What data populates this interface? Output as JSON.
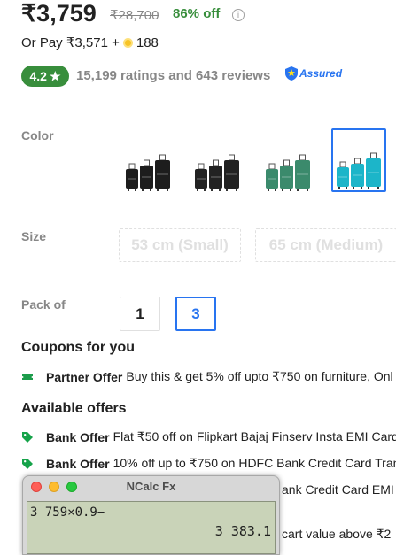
{
  "price": {
    "current": "₹3,759",
    "mrp": "₹28,700",
    "discount": "86% off",
    "or_pay": "Or Pay ₹3,571 +",
    "coins": "188"
  },
  "rating": {
    "value": "4.2",
    "star": "★",
    "summary": "15,199 ratings and 643 reviews",
    "assured_label": "Assured"
  },
  "labels": {
    "color": "Color",
    "size": "Size",
    "pack": "Pack of"
  },
  "color_options": [
    {
      "name": "black",
      "colors": [
        "#1d1d1d",
        "#1d1d1d",
        "#1d1d1d"
      ],
      "selected": false
    },
    {
      "name": "black-alt",
      "colors": [
        "#222222",
        "#222222",
        "#222222"
      ],
      "selected": false
    },
    {
      "name": "green",
      "colors": [
        "#3b8a6c",
        "#3b8a6c",
        "#3b8a6c"
      ],
      "selected": false
    },
    {
      "name": "teal",
      "colors": [
        "#1cb5c9",
        "#1cb5c9",
        "#1cb5c9"
      ],
      "selected": true
    }
  ],
  "sizes": [
    "53 cm (Small)",
    "65 cm (Medium)"
  ],
  "packs": [
    {
      "label": "1",
      "selected": false
    },
    {
      "label": "3",
      "selected": true
    }
  ],
  "coupons": {
    "title": "Coupons for you",
    "items": [
      {
        "bold": "Partner Offer",
        "text": "Buy this & get 5% off upto ₹750 on furniture, Onl"
      }
    ]
  },
  "offers": {
    "title": "Available offers",
    "items": [
      {
        "bold": "Bank Offer",
        "text": "Flat ₹50 off on Flipkart Bajaj Finserv Insta EMI Card"
      },
      {
        "bold": "Bank Offer",
        "text": "10% off up to ₹750 on HDFC Bank Credit Card Tran"
      },
      {
        "bold": "",
        "text": "ank Credit Card EMI"
      },
      {
        "bold": "",
        "text": "cart value above ₹2"
      }
    ]
  },
  "ncalc": {
    "title": "NCalc Fx",
    "expression": "3 759×0.9−",
    "result": "3 383.1"
  },
  "colors": {
    "accent": "#2874f0",
    "green": "#388e3c",
    "muted": "#878787"
  }
}
